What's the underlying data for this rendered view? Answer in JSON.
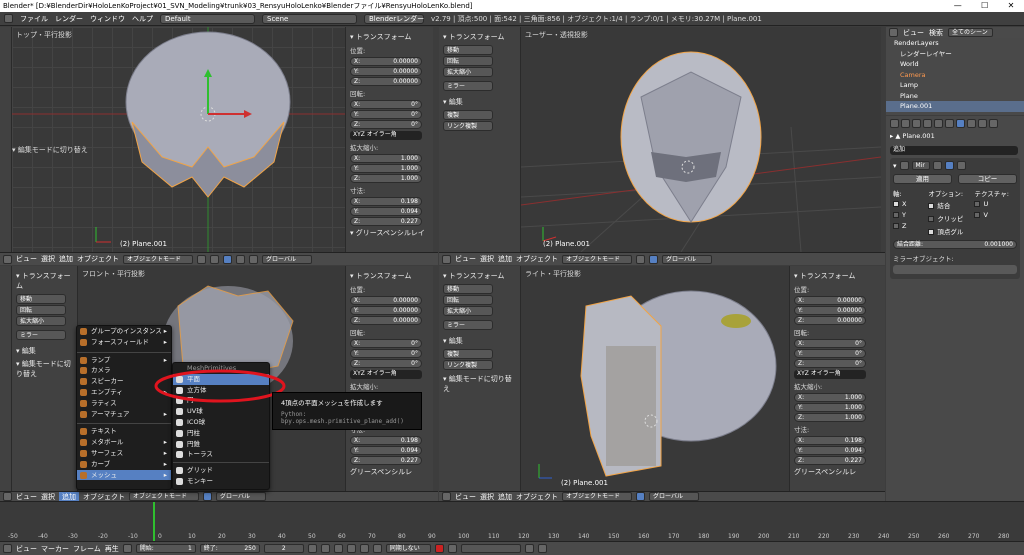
{
  "window": {
    "title": "Blender* [D:¥BlenderDir¥HoloLenKoProject¥01_SVN_Modeling¥trunk¥03_RensyuHoloLenko¥Blenderファイル¥RensyuHoloLenKo.blend]"
  },
  "infobar": {
    "menus": [
      "ファイル",
      "レンダー",
      "ウィンドウ",
      "ヘルプ"
    ],
    "layout": "Default",
    "scene": "Scene",
    "engine": "Blenderレンダー",
    "stats": "v2.79 | 頂点:500 | 面:542 | 三角面:856 | オブジェクト:1/4 | ランプ:0/1 | メモリ:30.27M | Plane.001"
  },
  "viewports": {
    "top_left": {
      "label": "トップ・平行投影",
      "object": "(2) Plane.001",
      "toolbar_item": "▾ 編集モードに切り替え"
    },
    "top_right": {
      "label": "ユーザー・透視投影",
      "object": "(2) Plane.001"
    },
    "bottom_left": {
      "label": "フロント・平行投影"
    },
    "bottom_right": {
      "label": "ライト・平行投影",
      "object": "(2) Plane.001"
    }
  },
  "header": {
    "view": "ビュー",
    "select": "選択",
    "add": "追加",
    "object": "オブジェクト",
    "mode": "オブジェクトモード",
    "orientation": "グローバル"
  },
  "tool_shelf": {
    "section_transform": "▾ トランスフォーム",
    "translate": "移動",
    "rotate": "回転",
    "scale": "拡大縮小",
    "mirror": "ミラー",
    "section_edit": "▾ 編集",
    "duplicate": "複製",
    "link_duplicate": "リンク複製",
    "edit_mode_toggle": "▾ 編集モードに切り替え"
  },
  "npanel": {
    "transform": "▾ トランスフォーム",
    "location": "位置:",
    "loc_x": "X:",
    "loc_x_val": "0.00000",
    "loc_y": "Y:",
    "loc_y_val": "0.00000",
    "loc_z": "Z:",
    "loc_z_val": "0.00000",
    "rotation": "回転:",
    "rot_x": "X:",
    "rot_x_val": "0°",
    "rot_y": "Y:",
    "rot_y_val": "0°",
    "rot_z": "Z:",
    "rot_z_val": "0°",
    "rot_mode": "XYZ オイラー角",
    "scale": "拡大縮小:",
    "scale_x": "X:",
    "scale_x_val": "1.000",
    "scale_y": "Y:",
    "scale_y_val": "1.000",
    "scale_z": "Z:",
    "scale_z_val": "1.000",
    "dimensions": "寸法:",
    "dim_x": "X:",
    "dim_x_val": "0.198",
    "dim_y": "Y:",
    "dim_y_val": "0.094",
    "dim_z": "Z:",
    "dim_z_val": "0.227",
    "grease": "▾ グリースペンシルレイ",
    "grease_short": "グリースペンシルレ"
  },
  "add_menu": {
    "items": [
      {
        "label": "グループのインスタンス",
        "arrow": "▸"
      },
      {
        "label": "フォースフィールド",
        "arrow": "▸"
      },
      {
        "label": "ランプ",
        "arrow": "▸"
      },
      {
        "label": "カメラ",
        "arrow": ""
      },
      {
        "label": "スピーカー",
        "arrow": ""
      },
      {
        "label": "エンプティ",
        "arrow": "▸"
      },
      {
        "label": "ラティス",
        "arrow": ""
      },
      {
        "label": "アーマチュア",
        "arrow": "▸"
      },
      {
        "label": "テキスト",
        "arrow": ""
      },
      {
        "label": "メタボール",
        "arrow": "▸"
      },
      {
        "label": "サーフェス",
        "arrow": "▸"
      },
      {
        "label": "カーブ",
        "arrow": "▸"
      },
      {
        "label": "メッシュ",
        "arrow": "▸"
      }
    ]
  },
  "mesh_menu": {
    "items": [
      "MeshPrimitives",
      "平面",
      "立方体",
      "円",
      "UV球",
      "ICO球",
      "円柱",
      "円錐",
      "トーラス",
      "グリッド",
      "モンキー"
    ]
  },
  "tooltip": {
    "title": "4頂点の平面メッシュを作成します",
    "python": "Python: bpy.ops.mesh.primitive_plane_add()"
  },
  "outliner": {
    "view": "ビュー",
    "search": "検索",
    "filter": "全てのシーン",
    "items": [
      "RenderLayers",
      "レンダーレイヤー",
      "World",
      "Camera",
      "Lamp",
      "Plane",
      "Plane.001"
    ]
  },
  "properties": {
    "object": "Plane.001",
    "add_modifier": "追加",
    "modifier_name": "Mir",
    "apply": "適用",
    "copy": "コピー",
    "axis": "軸:",
    "options": "オプション:",
    "texture": "テクスチャ:",
    "x": "X",
    "y": "Y",
    "z": "Z",
    "merge": "結合",
    "clipping": "クリッピ",
    "vgroups": "頂点グル",
    "u": "U",
    "v": "V",
    "merge_dist": "結合距離:",
    "merge_dist_val": "0.001000",
    "mirror_object": "ミラーオブジェクト:"
  },
  "timeline": {
    "ticks": [
      "-50",
      "-40",
      "-30",
      "-20",
      "-10",
      "0",
      "10",
      "20",
      "30",
      "40",
      "50",
      "60",
      "70",
      "80",
      "90",
      "100",
      "110",
      "120",
      "130",
      "140",
      "150",
      "160",
      "170",
      "180",
      "190",
      "200",
      "210",
      "220",
      "230",
      "240",
      "250",
      "260",
      "270",
      "280"
    ],
    "view": "ビュー",
    "marker": "マーカー",
    "frame": "フレーム",
    "playback": "再生",
    "start": "開始:",
    "start_val": "1",
    "end": "終了:",
    "end_val": "250",
    "current": "2",
    "sync": "同期しない"
  },
  "colors": {
    "accent": "#5680c2",
    "highlight_circle": "#e0141e",
    "selected_outline": "#f1a447"
  }
}
